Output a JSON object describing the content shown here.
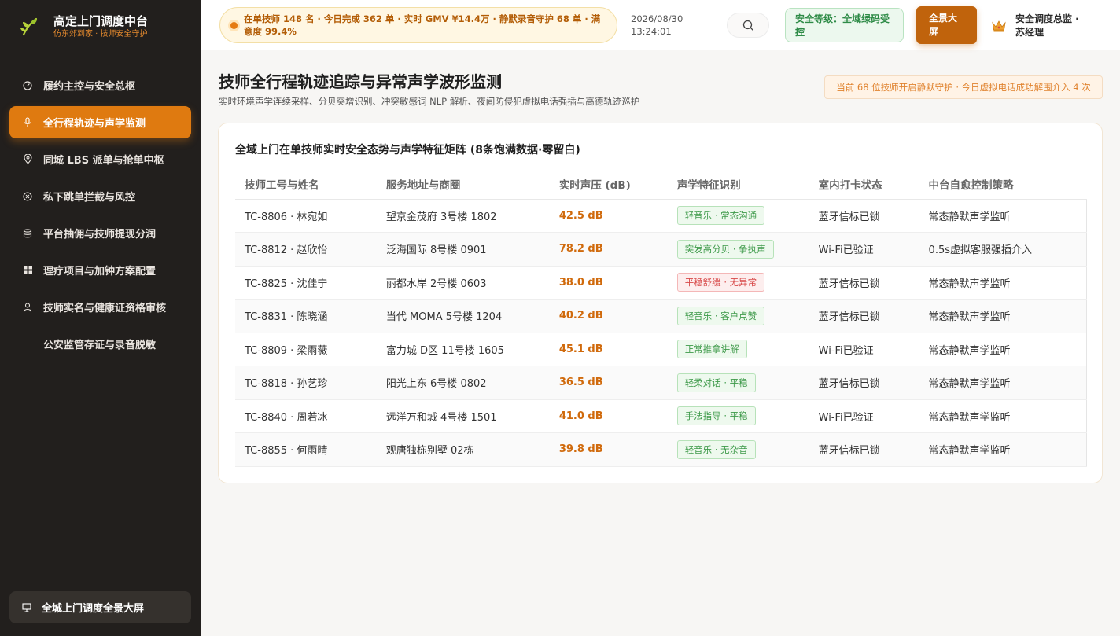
{
  "brand": {
    "title": "高定上门调度中台",
    "subtitle": "仿东郊到家 · 技师安全守护"
  },
  "sidebar": {
    "items": [
      {
        "label": "履约主控与安全总枢",
        "icon": "dashboard-icon"
      },
      {
        "label": "全行程轨迹与声学监测",
        "icon": "microphone-icon",
        "active": true
      },
      {
        "label": "同城 LBS 派单与抢单中枢",
        "icon": "location-pin-icon"
      },
      {
        "label": "私下跳单拦截与风控",
        "icon": "block-icon"
      },
      {
        "label": "平台抽佣与技师提现分润",
        "icon": "database-icon"
      },
      {
        "label": "理疗项目与加钟方案配置",
        "icon": "grid-icon"
      },
      {
        "label": "技师实名与健康证资格审核",
        "icon": "user-icon"
      },
      {
        "label": "公安监管存证与录音脱敏",
        "icon": ""
      }
    ],
    "bottom_label": "全城上门调度全景大屏"
  },
  "header": {
    "ticker": "在单技师 148 名 · 今日完成 362 单 · 实时 GMV ¥14.4万 · 静默录音守护 68 单 · 满意度 99.4%",
    "date": "2026/08/30",
    "time": "13:24:01",
    "safety_label": "安全等级：全域绿码受控",
    "overview_label": "全景大屏",
    "user_name": "安全调度总监 · 苏经理"
  },
  "main": {
    "title": "技师全行程轨迹追踪与异常声学波形监测",
    "subtitle": "实时环境声学连续采样、分贝突增识别、冲突敏感词 NLP 解析、夜间防侵犯虚拟电话强插与高德轨迹巡护",
    "notice": "当前 68 位技师开启静默守护 · 今日虚拟电话成功解围介入 4 次"
  },
  "table": {
    "title": "全域上门在单技师实时安全态势与声学特征矩阵 (8条饱满数据·零留白)",
    "headers": [
      "技师工号与姓名",
      "服务地址与商圈",
      "实时声压 (dB)",
      "声学特征识别",
      "室内打卡状态",
      "中台自愈控制策略"
    ],
    "rows": [
      {
        "tech": "TC-8806 · 林宛如",
        "address": "望京金茂府 3号楼 1802",
        "db": "42.5 dB",
        "feature": "轻音乐 · 常态沟通",
        "tag_color": "green",
        "checkin": "蓝牙信标已锁",
        "strategy": "常态静默声学监听"
      },
      {
        "tech": "TC-8812 · 赵欣怡",
        "address": "泛海国际 8号楼 0901",
        "db": "78.2 dB",
        "feature": "突发高分贝 · 争执声",
        "tag_color": "green",
        "checkin": "Wi-Fi已验证",
        "strategy": "0.5s虚拟客服强插介入"
      },
      {
        "tech": "TC-8825 · 沈佳宁",
        "address": "丽都水岸 2号楼 0603",
        "db": "38.0 dB",
        "feature": "平稳舒缓 · 无异常",
        "tag_color": "red",
        "checkin": "蓝牙信标已锁",
        "strategy": "常态静默声学监听"
      },
      {
        "tech": "TC-8831 · 陈晓涵",
        "address": "当代 MOMA 5号楼 1204",
        "db": "40.2 dB",
        "feature": "轻音乐 · 客户点赞",
        "tag_color": "green",
        "checkin": "蓝牙信标已锁",
        "strategy": "常态静默声学监听"
      },
      {
        "tech": "TC-8809 · 梁雨薇",
        "address": "富力城 D区 11号楼 1605",
        "db": "45.1 dB",
        "feature": "正常推拿讲解",
        "tag_color": "green",
        "checkin": "Wi-Fi已验证",
        "strategy": "常态静默声学监听"
      },
      {
        "tech": "TC-8818 · 孙艺珍",
        "address": "阳光上东 6号楼 0802",
        "db": "36.5 dB",
        "feature": "轻柔对话 · 平稳",
        "tag_color": "green",
        "checkin": "蓝牙信标已锁",
        "strategy": "常态静默声学监听"
      },
      {
        "tech": "TC-8840 · 周若冰",
        "address": "远洋万和城 4号楼 1501",
        "db": "41.0 dB",
        "feature": "手法指导 · 平稳",
        "tag_color": "green",
        "checkin": "Wi-Fi已验证",
        "strategy": "常态静默声学监听"
      },
      {
        "tech": "TC-8855 · 何雨晴",
        "address": "观唐独栋别墅 02栋",
        "db": "39.8 dB",
        "feature": "轻音乐 · 无杂音",
        "tag_color": "green",
        "checkin": "蓝牙信标已锁",
        "strategy": "常态静默声学监听"
      }
    ]
  },
  "colors": {
    "accent": "#df7a10",
    "sidebar_bg": "#221f1d",
    "safe_green": "#2e8b47",
    "alert_red": "#d84a4a"
  }
}
